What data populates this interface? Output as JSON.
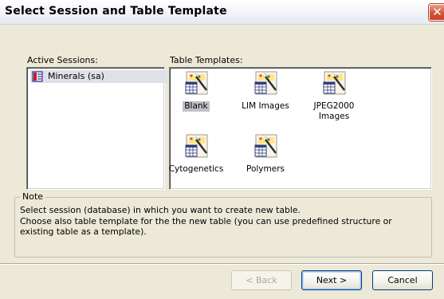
{
  "window": {
    "title": "Select Session and Table Template",
    "close_glyph": "✕"
  },
  "sessions": {
    "label": "Active Sessions:",
    "items": [
      {
        "label": "Minerals (sa)",
        "icon": "database-session-icon",
        "selected": true
      }
    ]
  },
  "templates": {
    "label": "Table Templates:",
    "items": [
      {
        "label": "Blank",
        "icon": "table-template-icon",
        "selected": true
      },
      {
        "label": "LIM Images",
        "icon": "table-template-icon",
        "selected": false
      },
      {
        "label": "JPEG2000\nImages",
        "icon": "table-template-icon",
        "selected": false
      },
      {
        "label": "Cytogenetics",
        "icon": "table-template-icon",
        "selected": false
      },
      {
        "label": "Polymers",
        "icon": "table-template-icon",
        "selected": false
      }
    ]
  },
  "note": {
    "legend": "Note",
    "line1": "Select session (database) in which you want to create new table.",
    "line2": "Choose also table template for the the new table (you can use predefined structure or existing table as a template)."
  },
  "buttons": {
    "back": "< Back",
    "next": "Next >",
    "cancel": "Cancel"
  },
  "colors": {
    "dialog_bg": "#ece9d8",
    "selection_gray": "#c0c0c8",
    "close_red": "#d2553a"
  }
}
